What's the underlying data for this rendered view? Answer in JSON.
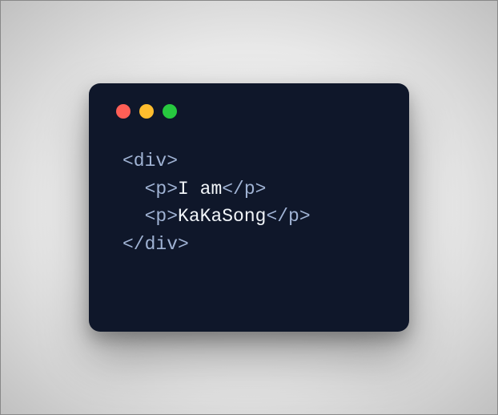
{
  "window_controls": {
    "red": "#ff5f56",
    "yellow": "#ffbd2e",
    "green": "#27c93f"
  },
  "code": {
    "open_div": "<div>",
    "p1_open": "<p>",
    "p1_text": "I am",
    "p1_close": "</p>",
    "p2_open": "<p>",
    "p2_text": "KaKaSong",
    "p2_close": "</p>",
    "close_div": "</div>",
    "indent": "  "
  }
}
